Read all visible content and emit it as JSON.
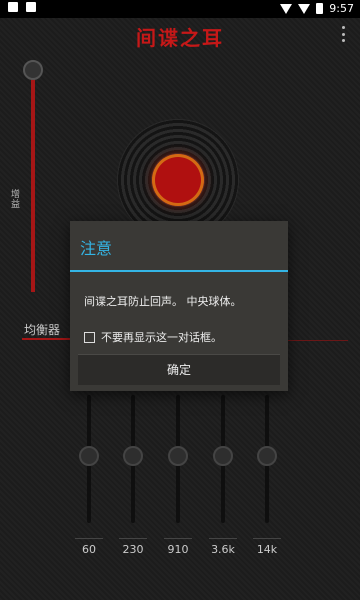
{
  "status_bar": {
    "time": "9:57",
    "left_icons": [
      "notification-icon",
      "android-icon"
    ],
    "right_icons": [
      "wifi-icon",
      "signal-icon",
      "battery-icon"
    ]
  },
  "app": {
    "title": "间谍之耳",
    "overflow_icon": "more-vert-icon",
    "accent_color": "#c61818"
  },
  "volume": {
    "label": "增益"
  },
  "equalizer": {
    "label": "均衡器",
    "bands": [
      {
        "label": "60"
      },
      {
        "label": "230"
      },
      {
        "label": "910"
      },
      {
        "label": "3.6k"
      },
      {
        "label": "14k"
      }
    ]
  },
  "dialog": {
    "title": "注意",
    "message": "间谍之耳防止回声。 中央球体。",
    "checkbox_label": "不要再显示这一对话框。",
    "checkbox_checked": false,
    "ok_button": "确定",
    "title_color": "#34b5e5"
  }
}
